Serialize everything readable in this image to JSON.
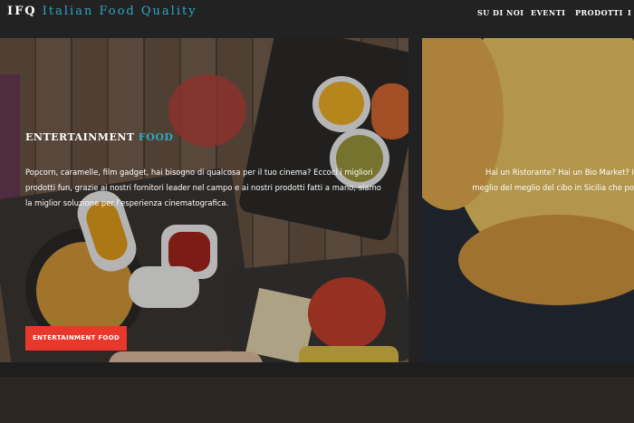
{
  "header": {
    "logo_part1": "IFQ",
    "logo_part2": "Italian Food Quality",
    "nav": [
      "SU DI NOI",
      "EVENTI",
      "PRODOTTI",
      "I"
    ]
  },
  "slides": [
    {
      "title_part1": "ENTERTAINMENT",
      "title_part2": "FOOD",
      "description": "Popcorn, caramelle, film gadget, hai bisogno di qualcosa per il tuo cinema? Eccoci i migliori prodotti fun, grazie ai nostri fornitori leader nel campo e ai nostri prodotti fatti a mano, siamo la miglior soluzione per l'esperienza cinematografica.",
      "button_label": "ENTERTAINMENT FOOD"
    },
    {
      "line1": "Hai un Ristorante? Hai un Bio Market? I",
      "line2": "meglio del meglio del cibo in Sicilia che po"
    }
  ],
  "colors": {
    "accent": "#2fa8c4",
    "button": "#e8382c",
    "background": "#222222"
  }
}
